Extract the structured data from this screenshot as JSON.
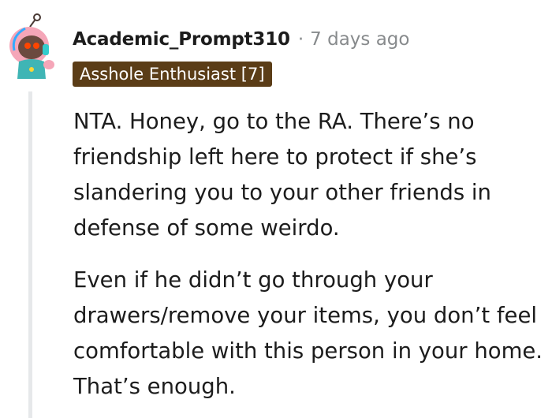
{
  "comment": {
    "username": "Academic_Prompt310",
    "separator": "·",
    "timestamp": "7 days ago",
    "flair": "Asshole Enthusiast [7]",
    "paragraphs": [
      "NTA. Honey, go to the RA. There’s no friendship left here to protect if she’s slandering you to your other friends in defense of some weirdo.",
      "Even if he didn’t go through your drawers/remove your items, you don’t feel comfortable with this person in your home. That’s enough."
    ]
  },
  "colors": {
    "flair_background": "#5b3d17",
    "muted_text": "#878a8c",
    "body_text": "#1c1c1c",
    "thread_line": "#e6e8ea"
  },
  "icons": {
    "avatar": "reddit-snoo-avatar"
  }
}
